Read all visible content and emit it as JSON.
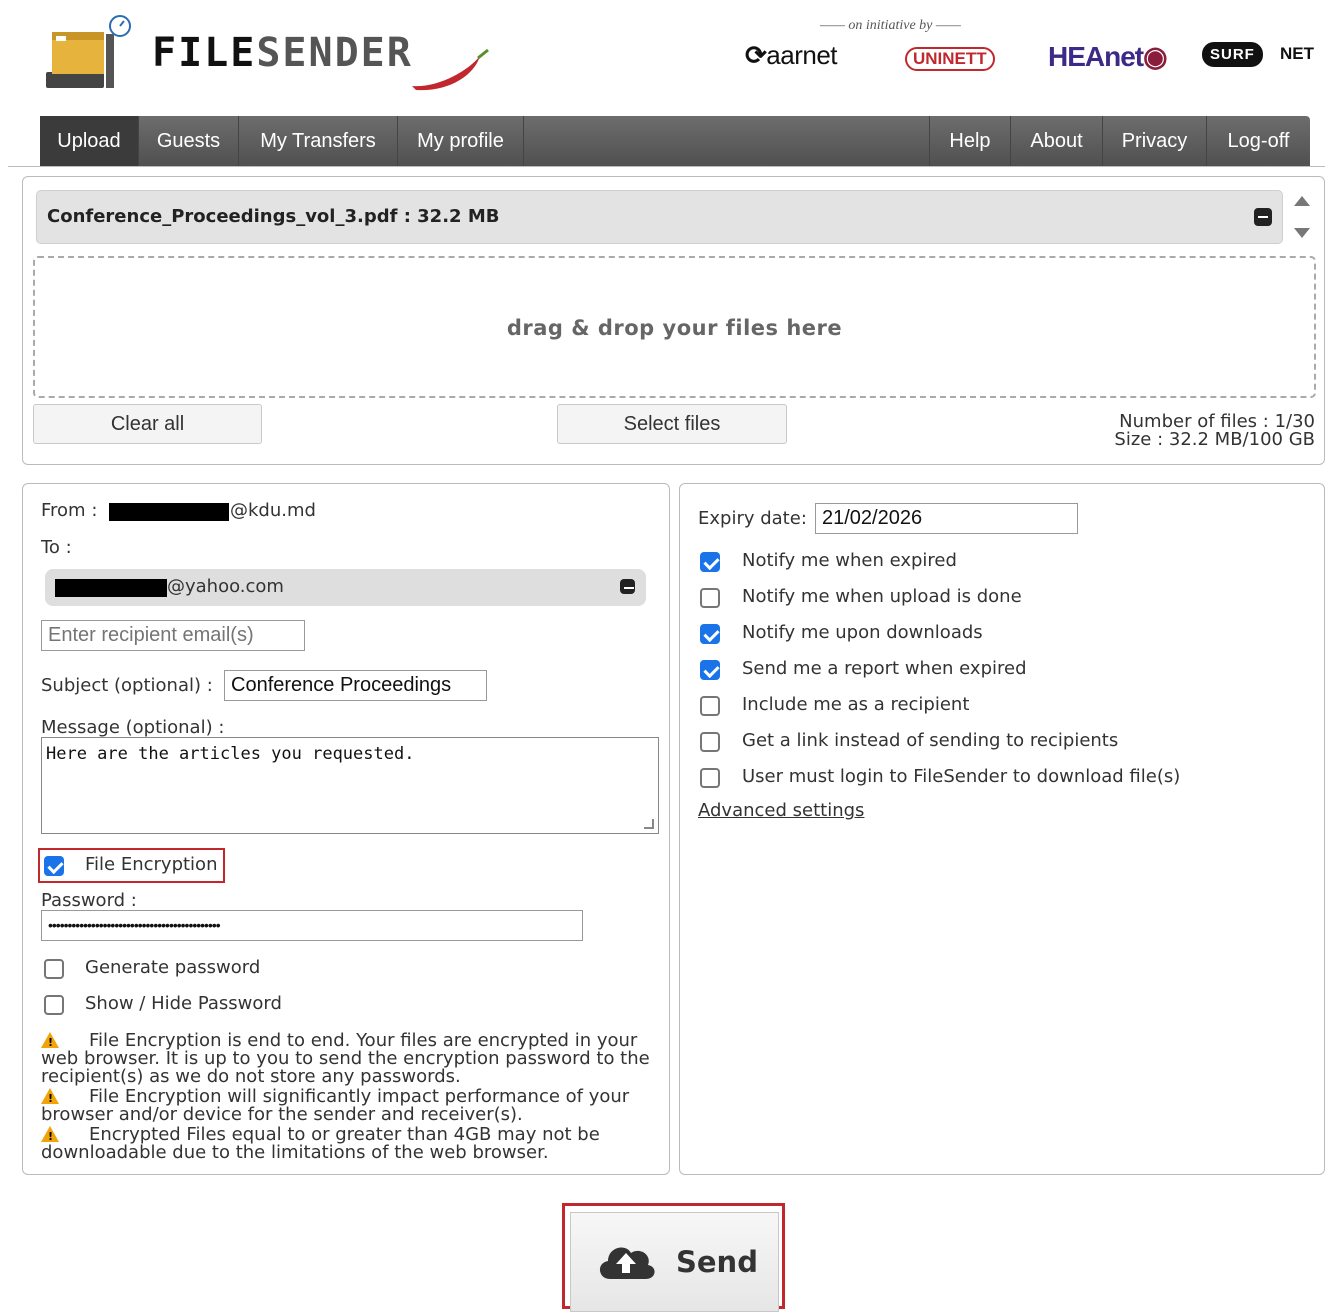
{
  "header": {
    "logo_text_bold": "FILE",
    "logo_text_light": "SENDER",
    "initiative": "on initiative by",
    "partners": {
      "aarnet": "aarnet",
      "uninett": "UNINETT",
      "heanet": "HEAnet",
      "surf": "SURF",
      "net": "NET"
    }
  },
  "nav": {
    "left": [
      "Upload",
      "Guests",
      "My Transfers",
      "My profile"
    ],
    "right": [
      "Help",
      "About",
      "Privacy",
      "Log-off"
    ],
    "active": "Upload"
  },
  "upload": {
    "file_entry": "Conference_Proceedings_vol_3.pdf : 32.2 MB",
    "dropzone_text": "drag & drop your files here",
    "clear_all": "Clear all",
    "select_files": "Select files",
    "number_of_files": "Number of files : 1/30",
    "size": "Size : 32.2 MB/100 GB"
  },
  "form": {
    "from_label": "From :",
    "from_domain": "@kdu.md",
    "to_label": "To :",
    "recipient_domain": "@yahoo.com",
    "recipient_placeholder": "Enter recipient email(s)",
    "subject_label": "Subject (optional) :",
    "subject_value": "Conference Proceedings",
    "message_label": "Message (optional) :",
    "message_value": "Here are the articles you requested.",
    "encryption_label": "File Encryption",
    "encryption_checked": true,
    "password_label": "Password :",
    "password_mask": "••••••••••••••••••••••••••••••••••••••••••••",
    "generate_password": "Generate password",
    "show_hide_password": "Show / Hide Password",
    "warnings": [
      "File Encryption is end to end. Your files are encrypted in your web browser. It is up to you to send the encryption password to the recipient(s) as we do not store any passwords.",
      "File Encryption will significantly impact performance of your browser and/or device for the sender and receiver(s).",
      "Encrypted Files equal to or greater than 4GB may not be downloadable due to the limitations of the web browser."
    ]
  },
  "options": {
    "expiry_label": "Expiry date:",
    "expiry_value": "21/02/2026",
    "checkboxes": [
      {
        "label": "Notify me when expired",
        "checked": true
      },
      {
        "label": "Notify me when upload is done",
        "checked": false
      },
      {
        "label": "Notify me upon downloads",
        "checked": true
      },
      {
        "label": "Send me a report when expired",
        "checked": true
      },
      {
        "label": "Include me as a recipient",
        "checked": false
      },
      {
        "label": "Get a link instead of sending to recipients",
        "checked": false
      },
      {
        "label": "User must login to FileSender to download file(s)",
        "checked": false
      }
    ],
    "advanced_settings": "Advanced settings"
  },
  "send": {
    "label": "Send"
  },
  "colors": {
    "nav_bg": "#555555",
    "nav_active": "#3b3b3b",
    "highlight_red": "#c0282d",
    "checkbox_blue": "#1a73e8",
    "warning": "#f0a30a"
  }
}
